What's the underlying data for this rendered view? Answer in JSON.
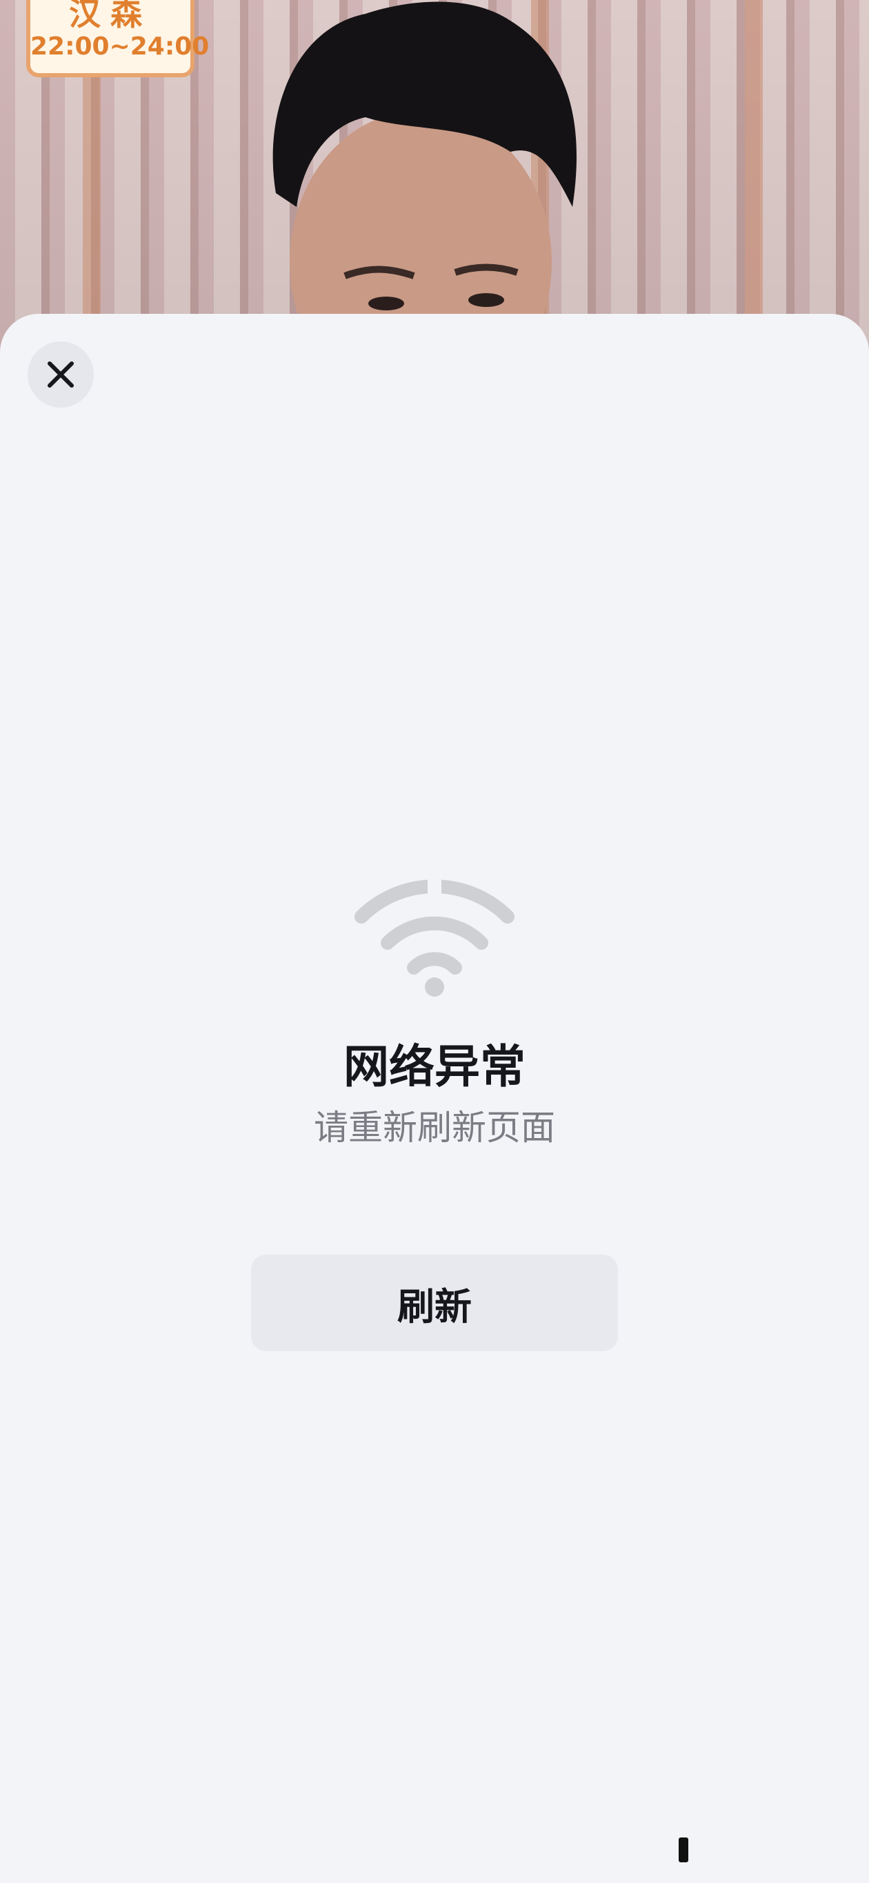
{
  "background": {
    "badge_name": "汉森",
    "badge_time": "22:00~24:00"
  },
  "sheet": {
    "close_icon": "close-icon",
    "status_icon": "wifi-icon",
    "title": "网络异常",
    "subtitle": "请重新刷新页面",
    "refresh_label": "刷新"
  },
  "colors": {
    "sheet_bg": "#f3f4f8",
    "title": "#16161d",
    "subtitle": "#7c7c84",
    "button_bg": "#e8e9ee",
    "icon_gray": "#cfd0d4"
  }
}
